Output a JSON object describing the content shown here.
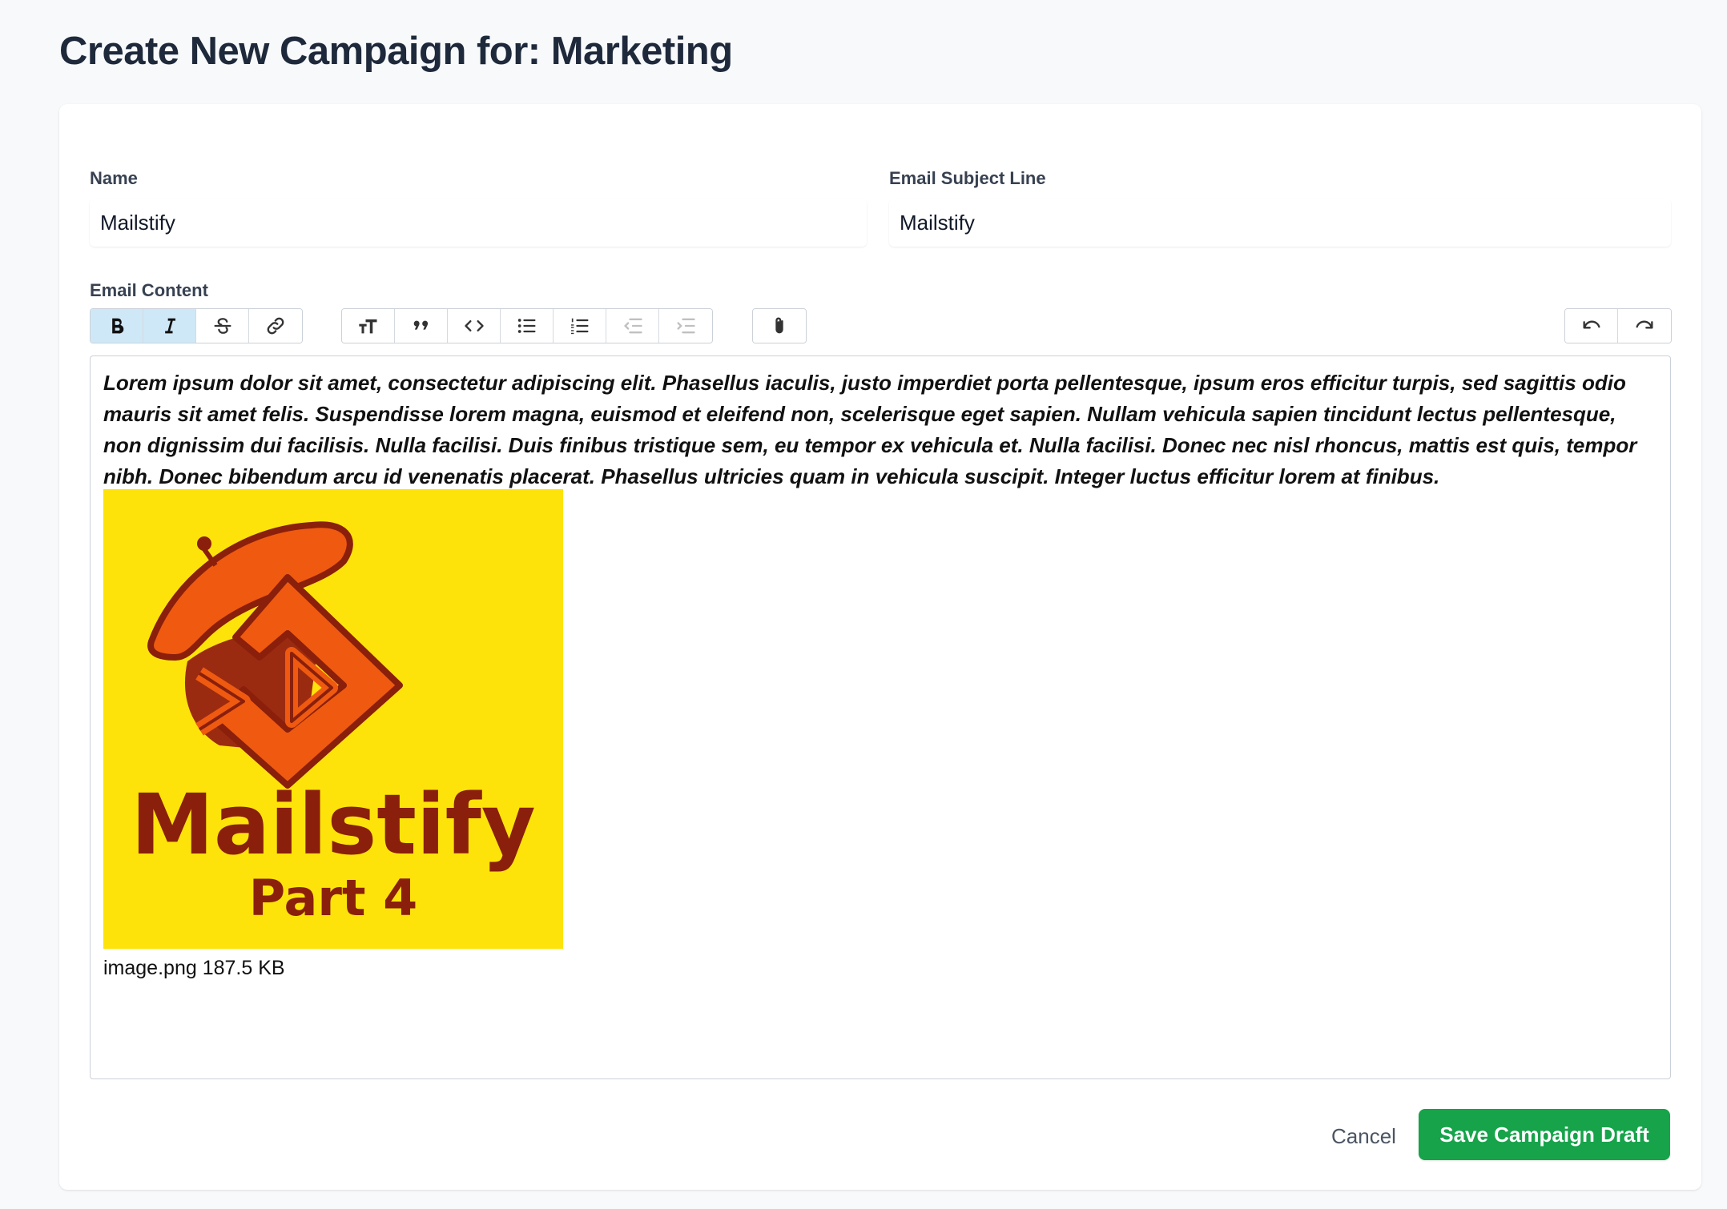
{
  "page": {
    "title": "Create New Campaign for: Marketing"
  },
  "form": {
    "name_label": "Name",
    "name_value": "Mailstify",
    "subject_label": "Email Subject Line",
    "subject_value": "Mailstify",
    "content_label": "Email Content"
  },
  "toolbar": {
    "groups": [
      [
        "bold-icon",
        "italic-icon",
        "strikethrough-icon",
        "link-icon"
      ],
      [
        "heading-icon",
        "quote-icon",
        "code-icon",
        "bullet-list-icon",
        "numbered-list-icon",
        "outdent-icon",
        "indent-icon"
      ],
      [
        "attach-icon"
      ],
      [
        "undo-icon",
        "redo-icon"
      ]
    ],
    "active": [
      "bold-icon",
      "italic-icon"
    ],
    "disabled": [
      "outdent-icon",
      "indent-icon"
    ]
  },
  "editor": {
    "body": "Lorem ipsum dolor sit amet, consectetur adipiscing elit. Phasellus iaculis, justo imperdiet porta pellentesque, ipsum eros efficitur turpis, sed sagittis odio mauris sit amet felis. Suspendisse lorem magna, euismod et eleifend non, scelerisque eget sapien. Nullam vehicula sapien tincidunt lectus pellentesque, non dignissim dui facilisis. Nulla facilisi. Duis finibus tristique sem, eu tempor ex vehicula et. Nulla facilisi. Donec nec nisl rhoncus, mattis est quis, tempor nibh. Donec bibendum arcu id venenatis placerat. Phasellus ultricies quam in vehicula suscipit. Integer luctus efficitur lorem at finibus.",
    "image_logo_line1": "Mailstify",
    "image_logo_line2": "Part 4",
    "attachment_name": "image.png",
    "attachment_size": "187.5 KB"
  },
  "actions": {
    "cancel_label": "Cancel",
    "save_label": "Save Campaign Draft"
  },
  "colors": {
    "primary_button": "#16a34a",
    "active_tool": "#cfe8f7",
    "logo_background": "#fde30a",
    "logo_orange": "#ef5a10",
    "logo_maroon": "#8a1f0b"
  }
}
